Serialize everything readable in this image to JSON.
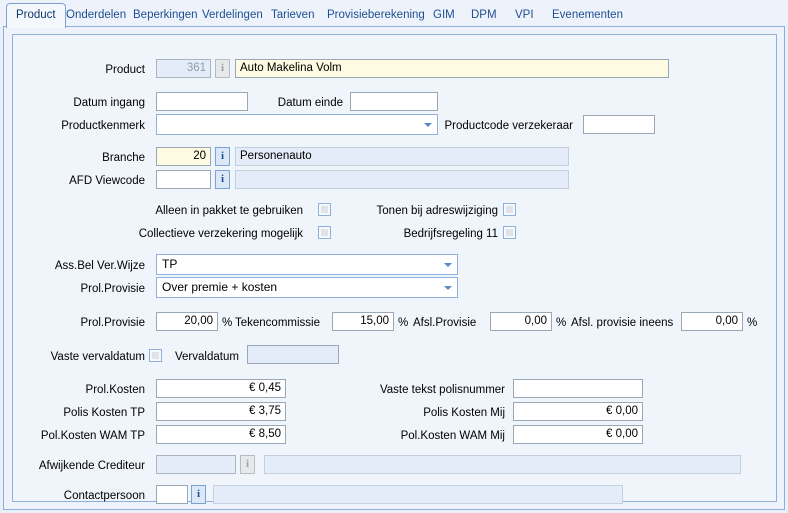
{
  "window": {
    "title": "Product"
  },
  "tabs": [
    {
      "label": "Product",
      "active": true
    },
    {
      "label": "Onderdelen",
      "active": false
    },
    {
      "label": "Beperkingen",
      "active": false
    },
    {
      "label": "Verdelingen",
      "active": false
    },
    {
      "label": "Tarieven",
      "active": false
    },
    {
      "label": "Provisieberekening",
      "active": false
    },
    {
      "label": "GIM",
      "active": false
    },
    {
      "label": "DPM",
      "active": false
    },
    {
      "label": "VPI",
      "active": false
    },
    {
      "label": "Evenementen",
      "active": false
    }
  ],
  "form": {
    "product": {
      "label": "Product",
      "code": "361",
      "name": "Auto Makelina Volm",
      "info_icon": "info-icon"
    },
    "datum_ingang": {
      "label": "Datum ingang",
      "value": ""
    },
    "datum_einde": {
      "label": "Datum einde",
      "value": ""
    },
    "productkenmerk": {
      "label": "Productkenmerk",
      "value": ""
    },
    "productcode_verzekeraar": {
      "label": "Productcode verzekeraar",
      "value": ""
    },
    "branche": {
      "label": "Branche",
      "code": "20",
      "description": "Personenauto"
    },
    "afd_viewcode": {
      "label": "AFD Viewcode",
      "code": "",
      "description": ""
    },
    "checkboxes": [
      {
        "label": "Alleen in pakket te gebruiken",
        "checked": false
      },
      {
        "label": "Tonen bij adreswijziging",
        "checked": false
      },
      {
        "label": "Collectieve verzekering mogelijk",
        "checked": false
      },
      {
        "label": "Bedrijfsregeling 11",
        "checked": false
      }
    ],
    "ass_bel_ver_wijze": {
      "label": "Ass.Bel Ver.Wijze",
      "value": "TP"
    },
    "prol_provisie_wijze": {
      "label": "Prol.Provisie",
      "value": "Over premie + kosten"
    },
    "prol_provisie": {
      "label": "Prol.Provisie",
      "value": "20,00",
      "unit": "%"
    },
    "tekencommissie": {
      "label": "Tekencommissie",
      "value": "15,00",
      "unit": "%"
    },
    "afsl_provisie": {
      "label": "Afsl.Provisie",
      "value": "0,00",
      "unit": "%"
    },
    "afsl_provisie_ineens": {
      "label": "Afsl. provisie ineens",
      "value": "0,00",
      "unit": "%"
    },
    "vaste_vervaldatum": {
      "label": "Vaste vervaldatum",
      "checked": false
    },
    "vervaldatum": {
      "label": "Vervaldatum",
      "value": ""
    },
    "prol_kosten": {
      "label": "Prol.Kosten",
      "value": "€ 0,45"
    },
    "polis_kosten_tp": {
      "label": "Polis Kosten TP",
      "value": "€ 3,75"
    },
    "pol_kosten_wam_tp": {
      "label": "Pol.Kosten WAM TP",
      "value": "€ 8,50"
    },
    "vaste_tekst_polisnummer": {
      "label": "Vaste tekst polisnummer",
      "value": ""
    },
    "polis_kosten_mij": {
      "label": "Polis Kosten Mij",
      "value": "€ 0,00"
    },
    "pol_kosten_wam_mij": {
      "label": "Pol.Kosten WAM Mij",
      "value": "€ 0,00"
    },
    "afwijkende_crediteur": {
      "label": "Afwijkende Crediteur",
      "code": "",
      "description": ""
    },
    "contactpersoon": {
      "label": "Contactpersoon",
      "code": "",
      "description": ""
    }
  },
  "colors": {
    "accent": "#1d4f91",
    "panel_border": "#8fb0da",
    "background": "#eef3fb",
    "highlight_field": "#fdfbe2",
    "readonly_field": "#e3ecf8"
  }
}
